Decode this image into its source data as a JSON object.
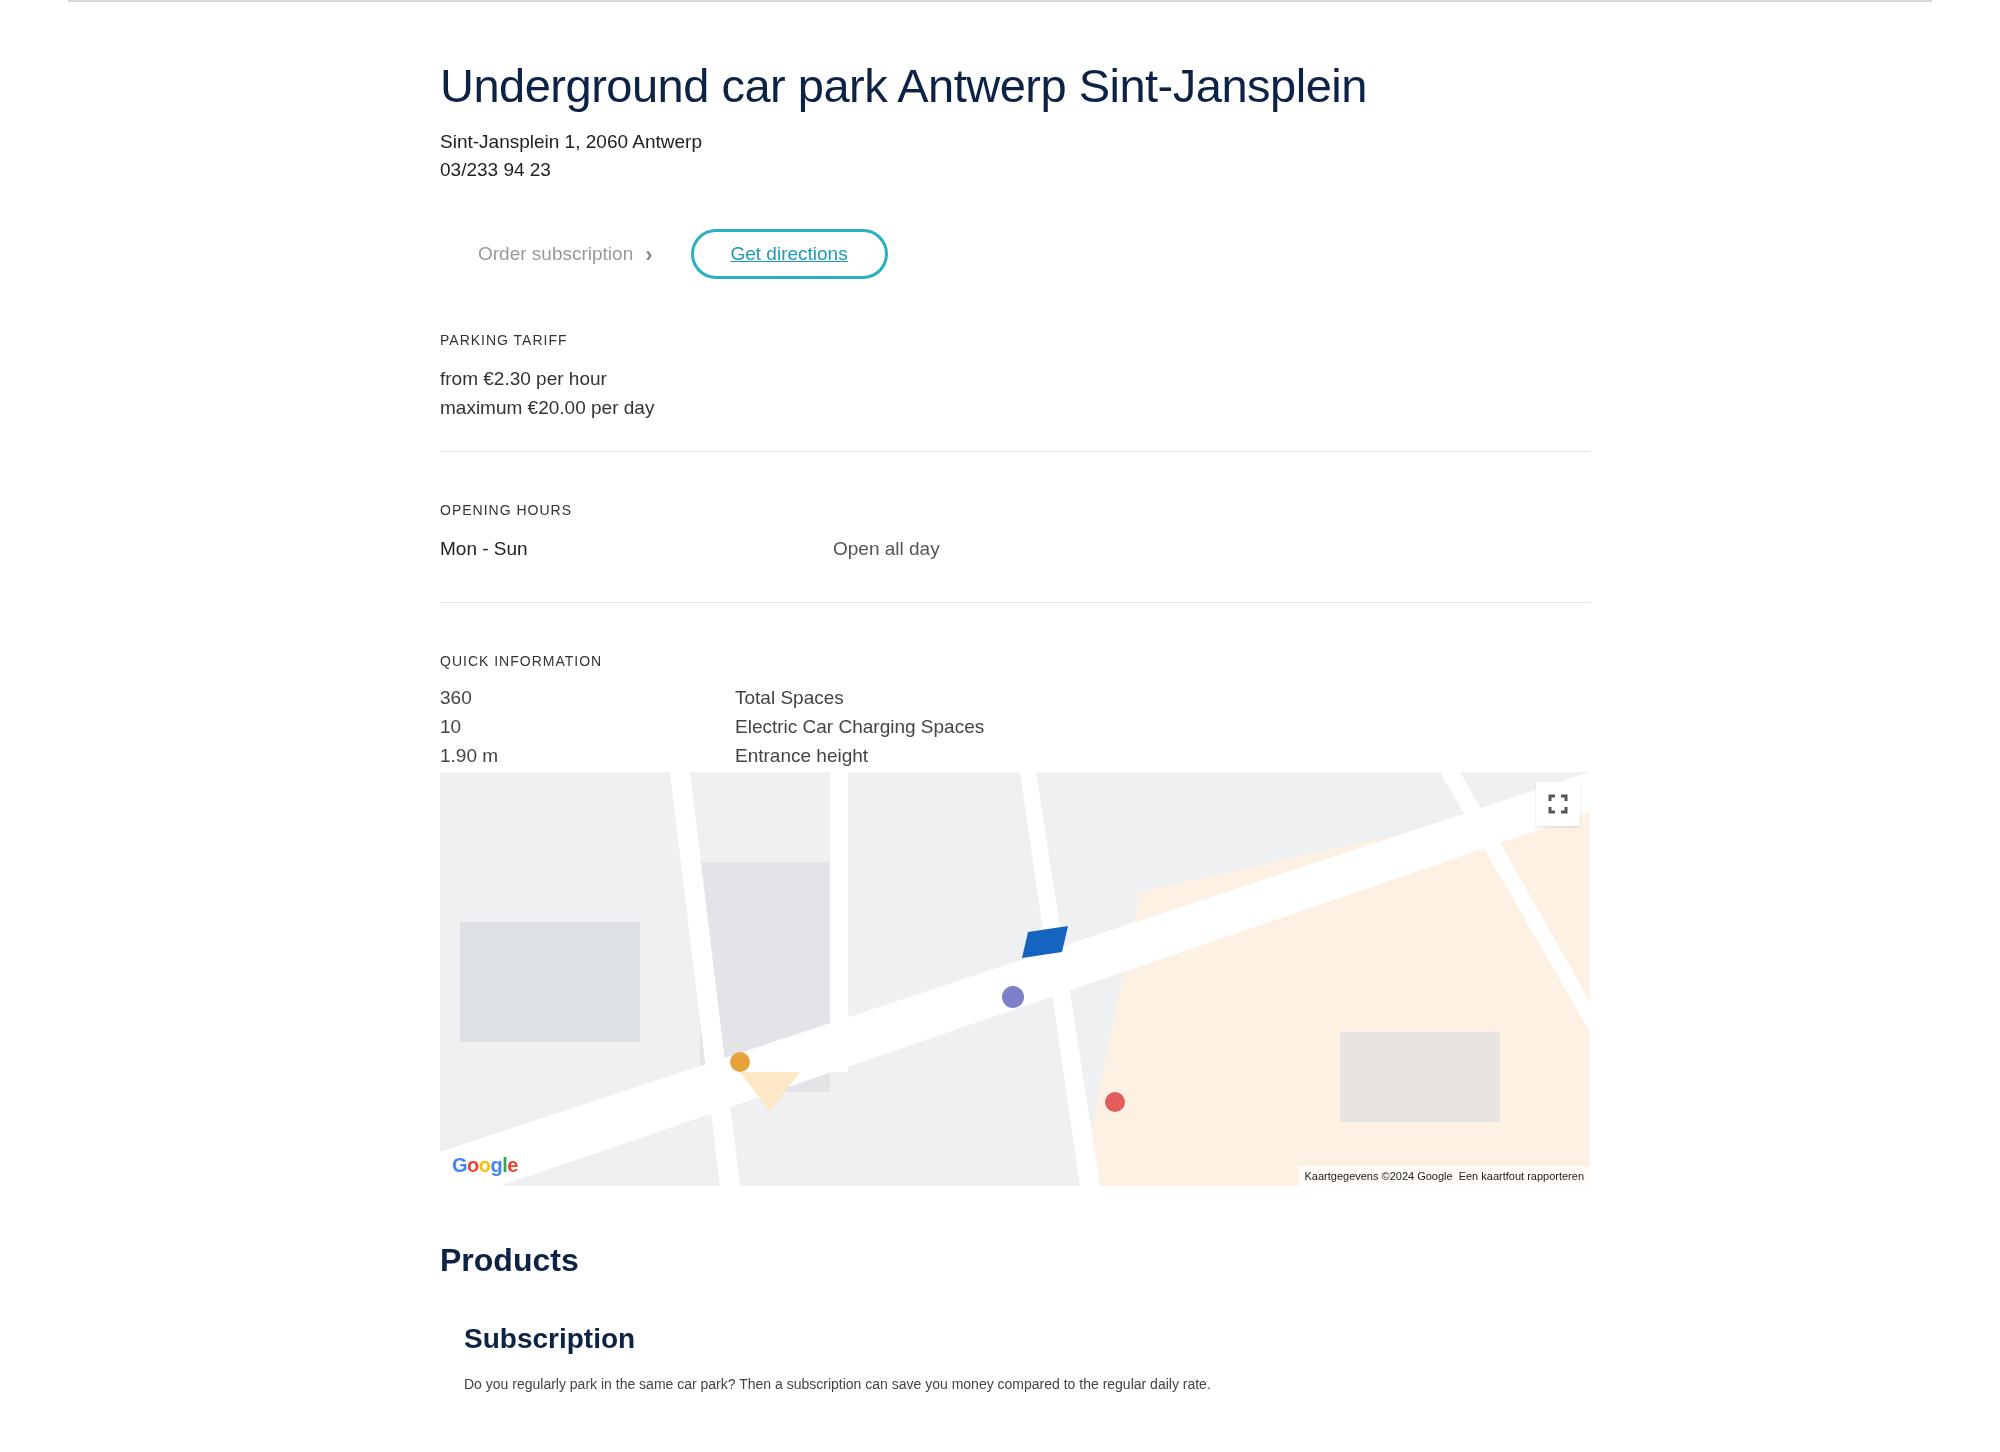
{
  "title": "Underground car park Antwerp Sint-Jansplein",
  "address": "Sint-Jansplein 1, 2060 Antwerp",
  "phone": "03/233 94 23",
  "actions": [
    {
      "kind": "link",
      "label": "Order subscription",
      "icon": "›"
    },
    {
      "kind": "outline",
      "label": "Get directions"
    }
  ],
  "tariff": {
    "heading": "PARKING TARIFF",
    "lines": [
      "from €2.30 per hour",
      "maximum €20.00 per day"
    ]
  },
  "opening_hours": {
    "heading": "OPENING HOURS",
    "rows": [
      {
        "days": "Mon - Sun",
        "hours": "Open all day"
      }
    ]
  },
  "quick_information": {
    "heading": "QUICK INFORMATION",
    "rows": [
      {
        "value": "360",
        "label": "Total Spaces"
      },
      {
        "value": "10",
        "label": "Electric Car Charging Spaces"
      },
      {
        "value": "1.90 m",
        "label": "Entrance height"
      }
    ]
  },
  "map": {
    "kind": "picture",
    "logo": "Google",
    "attribution": "Kaartgegevens ©2024 Google",
    "report_link": "Een kaartfout rapporteren"
  },
  "products": {
    "heading": "Products",
    "items": [
      {
        "title": "Subscription",
        "description": "Do you regularly park in the same car park? Then a subscription can save you money compared to the regular daily rate."
      }
    ]
  }
}
